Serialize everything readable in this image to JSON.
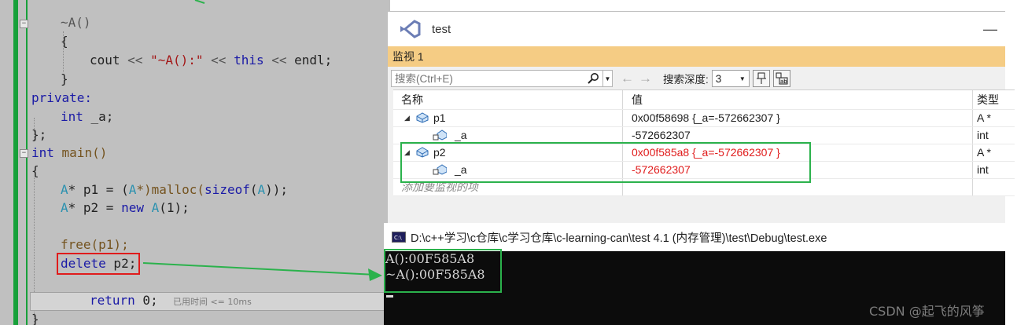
{
  "editor": {
    "lines": {
      "dtor_sig": "~A()",
      "brace_open1": "{",
      "cout_a": "cout",
      "cout_b": "<<",
      "cout_str": "\"~A():\"",
      "cout_c": "<<",
      "cout_this": "this",
      "cout_d": "<<",
      "cout_endl": "endl;",
      "brace_close1": "}",
      "private_kw": "private:",
      "int_kw": "int",
      "member_a": " _a;",
      "class_end": "};",
      "main_int": "int",
      "main_name": " main()",
      "brace_open2": "{",
      "p1_type": "A",
      "p1_rest": "* p1 = (",
      "p1_cast": "A",
      "p1_rest2": "*)malloc(",
      "p1_sizeof": "sizeof",
      "p1_paren": "(",
      "p1_A": "A",
      "p1_end": "));",
      "p2_type": "A",
      "p2_rest": "* p2 = ",
      "p2_new": "new",
      "p2_A": " A",
      "p2_end": "(1);",
      "free_call": "free(p1);",
      "delete_kw": "delete",
      "delete_rest": " p2;",
      "return_kw": "return",
      "return_rest": " 0;",
      "elapsed_hint": "已用时间 <= 10ms",
      "brace_close2": "}"
    }
  },
  "watch": {
    "window_title": "test",
    "minimize": "—",
    "tab_label": "监视 1",
    "search_placeholder": "搜索(Ctrl+E)",
    "depth_label": "搜索深度:",
    "depth_value": "3",
    "columns": {
      "name": "名称",
      "value": "值",
      "type": "类型"
    },
    "rows": [
      {
        "name": "p1",
        "value": "0x00f58698 {_a=-572662307 }",
        "type": "A *"
      },
      {
        "name": "_a",
        "value": "-572662307",
        "type": "int"
      },
      {
        "name": "p2",
        "value": "0x00f585a8 {_a=-572662307 }",
        "type": "A *"
      },
      {
        "name": "_a",
        "value": "-572662307",
        "type": "int"
      }
    ],
    "add_watch_text": "添加要监视的项",
    "colors": {
      "highlight_tab": "#f5cc84",
      "changed_value": "#e01b1b",
      "annotation_box": "#2bb24c"
    }
  },
  "console": {
    "title": "D:\\c++学习\\c仓库\\c学习仓库\\c-learning-can\\test 4.1 (内存管理)\\test\\Debug\\test.exe",
    "output": [
      "A():00F585A8",
      "~A():00F585A8"
    ]
  },
  "watermark": "CSDN @起飞的风筝"
}
